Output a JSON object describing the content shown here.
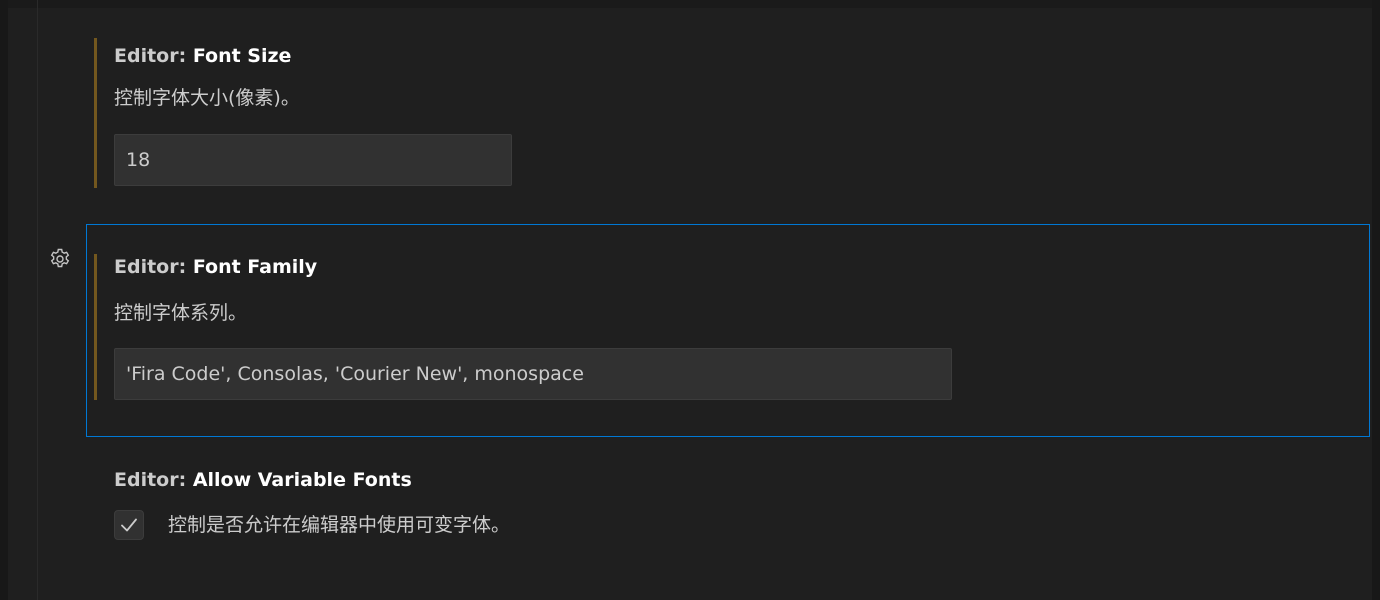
{
  "colors": {
    "background": "#1f1f1f",
    "focus_border": "#0078d4",
    "modified_indicator": "#73571e",
    "input_background": "#313131",
    "text": "#cccccc",
    "title_key": "#ffffff"
  },
  "settings": [
    {
      "category": "Editor: ",
      "name": "Font Size",
      "description": "控制字体大小(像素)。",
      "value": "18",
      "modified": true,
      "focused": false
    },
    {
      "category": "Editor: ",
      "name": "Font Family",
      "description": "控制字体系列。",
      "value": "'Fira Code', Consolas, 'Courier New', monospace",
      "modified": true,
      "focused": true,
      "gear_icon": "gear-icon"
    },
    {
      "category": "Editor: ",
      "name": "Allow Variable Fonts",
      "description": "控制是否允许在编辑器中使用可变字体。",
      "checked": true,
      "modified": false,
      "focused": false
    }
  ]
}
